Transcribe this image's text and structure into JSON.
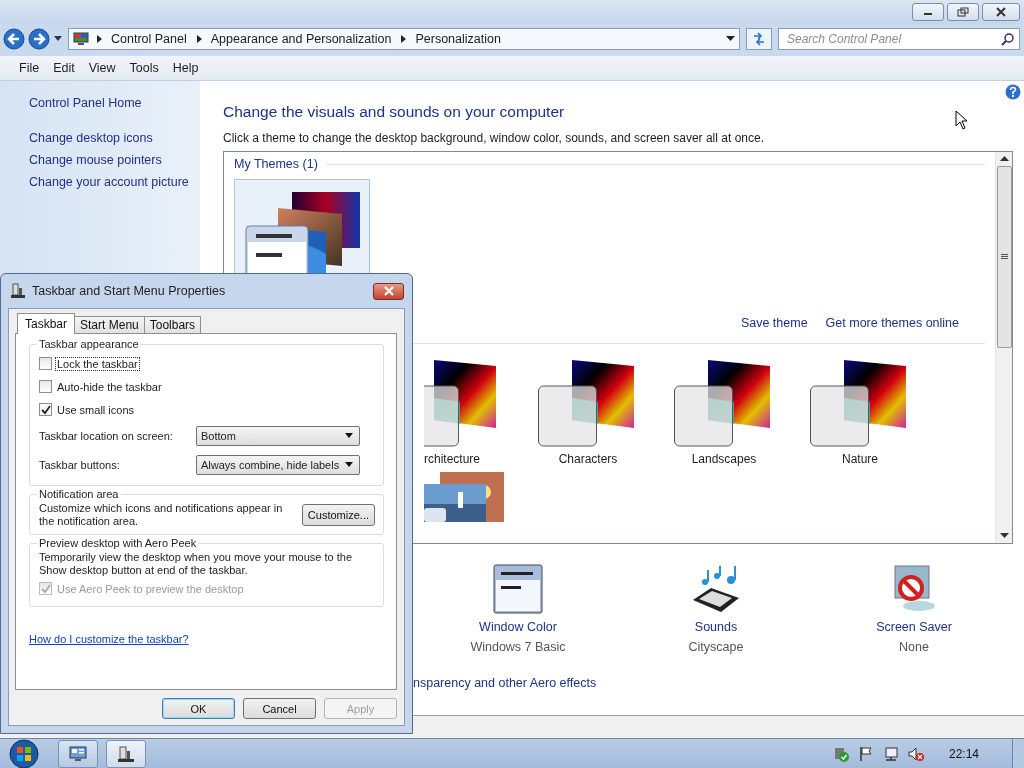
{
  "window": {
    "breadcrumb": [
      "Control Panel",
      "Appearance and Personalization",
      "Personalization"
    ],
    "search": {
      "placeholder": "Search Control Panel"
    }
  },
  "menu": [
    {
      "label": "File"
    },
    {
      "label": "Edit"
    },
    {
      "label": "View"
    },
    {
      "label": "Tools"
    },
    {
      "label": "Help"
    }
  ],
  "sidebar": {
    "items": [
      "Control Panel Home",
      "Change desktop icons",
      "Change mouse pointers",
      "Change your account picture"
    ]
  },
  "content": {
    "title": "Change the visuals and sounds on your computer",
    "description": "Click a theme to change the desktop background, window color, sounds, and screen saver all at once.",
    "my_themes": {
      "heading": "My Themes (1)"
    },
    "links": [
      "Save theme",
      "Get more themes online"
    ],
    "themes": [
      {
        "label": "rchitecture",
        "kind": "cut"
      },
      {
        "label": "Characters",
        "kind": "full"
      },
      {
        "label": "Landscapes",
        "kind": "full"
      },
      {
        "label": "Nature",
        "kind": "full"
      }
    ],
    "settings": [
      {
        "kind": "window_color",
        "label": "Window Color",
        "value": "Windows 7 Basic"
      },
      {
        "kind": "sounds",
        "label": "Sounds",
        "value": "Cityscape"
      },
      {
        "kind": "screen_saver",
        "label": "Screen Saver",
        "value": "None"
      }
    ],
    "aero_link": "nsparency and other Aero effects"
  },
  "dialog": {
    "title": "Taskbar and Start Menu Properties",
    "tabs": [
      {
        "label": "Taskbar",
        "selected": true
      },
      {
        "label": "Start Menu",
        "selected": false
      },
      {
        "label": "Toolbars",
        "selected": false
      }
    ],
    "appearance": {
      "heading": "Taskbar appearance",
      "checkboxes": [
        {
          "label": "Lock the taskbar",
          "checked": false,
          "focused": true
        },
        {
          "label": "Auto-hide the taskbar",
          "checked": false,
          "focused": false
        },
        {
          "label": "Use small icons",
          "checked": true,
          "focused": false
        }
      ],
      "dropdowns": [
        {
          "label": "Taskbar location on screen:",
          "value": "Bottom"
        },
        {
          "label": "Taskbar buttons:",
          "value": "Always combine, hide labels"
        }
      ]
    },
    "notification": {
      "heading": "Notification area",
      "text": "Customize which icons and notifications appear in the notification area.",
      "button": "Customize..."
    },
    "peek": {
      "heading": "Preview desktop with Aero Peek",
      "text": "Temporarily view the desktop when you move your mouse to the Show desktop button at end of the taskbar.",
      "checkbox": {
        "label": "Use Aero Peek to preview the desktop",
        "checked": true,
        "disabled": true
      }
    },
    "help_link": "How do I customize the taskbar?",
    "buttons": [
      {
        "label": "OK",
        "default": true,
        "disabled": false
      },
      {
        "label": "Cancel",
        "default": false,
        "disabled": false
      },
      {
        "label": "Apply",
        "default": false,
        "disabled": true
      }
    ]
  },
  "taskbar": {
    "clock": "22:14"
  }
}
